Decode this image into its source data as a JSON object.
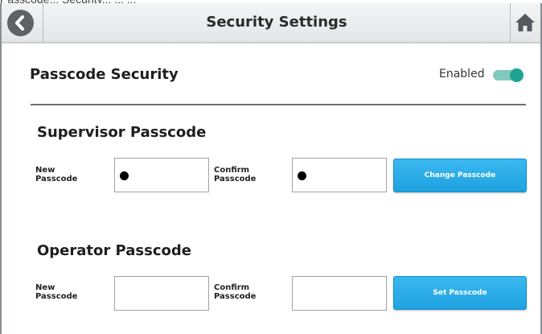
{
  "caption": "Passcode... Security... ... ...",
  "header": {
    "title": "Security Settings",
    "back_icon": "chevron-left-icon",
    "home_icon": "home-icon"
  },
  "passcode_security": {
    "title": "Passcode Security",
    "status_label": "Enabled",
    "enabled": true,
    "toggle_color": "#1ea393"
  },
  "supervisor": {
    "title": "Supervisor Passcode",
    "new_label_1": "New",
    "new_label_2": "Passcode",
    "confirm_label_1": "Confirm",
    "confirm_label_2": "Passcode",
    "new_value": "•",
    "confirm_value": "•",
    "button_label": "Change Passcode"
  },
  "operator": {
    "title": "Operator Passcode",
    "new_label_1": "New",
    "new_label_2": "Passcode",
    "confirm_label_1": "Confirm",
    "confirm_label_2": "Passcode",
    "new_value": "",
    "confirm_value": "",
    "button_label": "Set Passcode"
  },
  "colors": {
    "accent_button": "#2aaee8",
    "toggle_active": "#1ea393"
  }
}
